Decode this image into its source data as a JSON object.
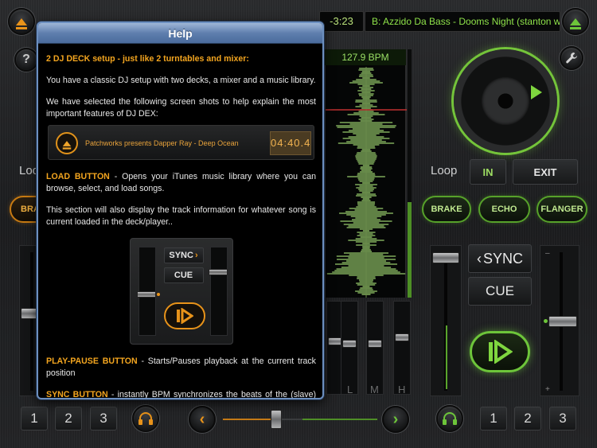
{
  "top_bar": {
    "time_remaining": "-3:23",
    "track_title": "B: Azzido Da Bass - Dooms Night (stanton warriors"
  },
  "waveform": {
    "bpm": "127.9 BPM"
  },
  "left_deck": {
    "loop_label": "Loo",
    "brake_label": "BRA",
    "pitch_fader_value": 0.5
  },
  "right_deck": {
    "loop_label": "Loop",
    "loop_in_label": "IN",
    "loop_exit_label": "EXIT",
    "effects": [
      "BRAKE",
      "ECHO",
      "FLANGER"
    ],
    "sync_label": "SYNC",
    "cue_label": "CUE",
    "pitch_fader_value": 0.5,
    "volume_fader_value": 0.85
  },
  "mixer": {
    "eq_labels": [
      "L",
      "M",
      "H"
    ]
  },
  "bottom_bar": {
    "left_hotcues": [
      "1",
      "2",
      "3"
    ],
    "right_hotcues": [
      "1",
      "2",
      "3"
    ],
    "crossfader_value": 0.3
  },
  "colors": {
    "accent_green": "#74c43a",
    "accent_orange": "#e8931a",
    "dialog_blue": "#5f7fae"
  },
  "help": {
    "title": "Help",
    "heading": "2 DJ DECK setup - just like 2 turntables and mixer:",
    "p1": "You have a classic DJ setup with two decks, a mixer and a music library.",
    "p2": "We have selected the following screen shots to help explain the most important features of DJ DEX:",
    "example_track": "Patchworks presents Dapper Ray - Deep Ocean",
    "example_time": "04:40.4",
    "load_term": "LOAD BUTTON",
    "load_text": " - Opens your iTunes music library where you can browse, select, and load songs.",
    "p3": "This section will also display the track information for whatever song is current loaded in the deck/player..",
    "example_sync": "SYNC",
    "example_cue": "CUE",
    "play_term": "PLAY-PAUSE BUTTON",
    "play_text": " - Starts/Pauses playback at the current track position",
    "sync_term": "SYNC BUTTON",
    "sync_text": " - instantly BPM synchronizes the beats of the (slave) deck to the other (master) deck; NOTE: BPM Syncing will only function once DJ DEX has automatically calculated the BPM - which occurs the first time you"
  }
}
